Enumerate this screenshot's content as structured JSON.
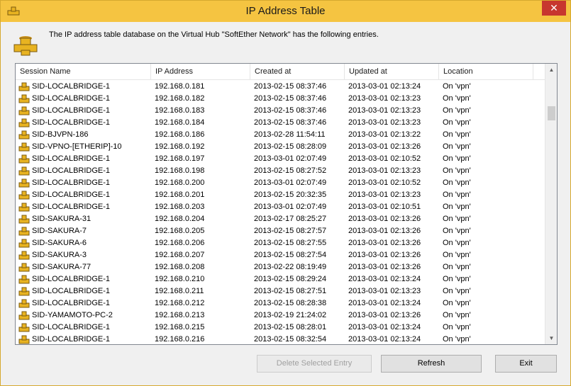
{
  "window": {
    "title": "IP Address Table",
    "close_glyph": "✕"
  },
  "description": "The IP address table database on the Virtual Hub \"SoftEther Network\" has the following entries.",
  "table": {
    "columns": [
      "Session Name",
      "IP Address",
      "Created at",
      "Updated at",
      "Location"
    ],
    "rows": [
      [
        "SID-LOCALBRIDGE-1",
        "192.168.0.181",
        "2013-02-15 08:37:46",
        "2013-03-01 02:13:24",
        "On 'vpn'"
      ],
      [
        "SID-LOCALBRIDGE-1",
        "192.168.0.182",
        "2013-02-15 08:37:46",
        "2013-03-01 02:13:23",
        "On 'vpn'"
      ],
      [
        "SID-LOCALBRIDGE-1",
        "192.168.0.183",
        "2013-02-15 08:37:46",
        "2013-03-01 02:13:23",
        "On 'vpn'"
      ],
      [
        "SID-LOCALBRIDGE-1",
        "192.168.0.184",
        "2013-02-15 08:37:46",
        "2013-03-01 02:13:23",
        "On 'vpn'"
      ],
      [
        "SID-BJVPN-186",
        "192.168.0.186",
        "2013-02-28 11:54:11",
        "2013-03-01 02:13:22",
        "On 'vpn'"
      ],
      [
        "SID-VPNO-[ETHERIP]-10",
        "192.168.0.192",
        "2013-02-15 08:28:09",
        "2013-03-01 02:13:26",
        "On 'vpn'"
      ],
      [
        "SID-LOCALBRIDGE-1",
        "192.168.0.197",
        "2013-03-01 02:07:49",
        "2013-03-01 02:10:52",
        "On 'vpn'"
      ],
      [
        "SID-LOCALBRIDGE-1",
        "192.168.0.198",
        "2013-02-15 08:27:52",
        "2013-03-01 02:13:23",
        "On 'vpn'"
      ],
      [
        "SID-LOCALBRIDGE-1",
        "192.168.0.200",
        "2013-03-01 02:07:49",
        "2013-03-01 02:10:52",
        "On 'vpn'"
      ],
      [
        "SID-LOCALBRIDGE-1",
        "192.168.0.201",
        "2013-02-15 20:32:35",
        "2013-03-01 02:13:23",
        "On 'vpn'"
      ],
      [
        "SID-LOCALBRIDGE-1",
        "192.168.0.203",
        "2013-03-01 02:07:49",
        "2013-03-01 02:10:51",
        "On 'vpn'"
      ],
      [
        "SID-SAKURA-31",
        "192.168.0.204",
        "2013-02-17 08:25:27",
        "2013-03-01 02:13:26",
        "On 'vpn'"
      ],
      [
        "SID-SAKURA-7",
        "192.168.0.205",
        "2013-02-15 08:27:57",
        "2013-03-01 02:13:26",
        "On 'vpn'"
      ],
      [
        "SID-SAKURA-6",
        "192.168.0.206",
        "2013-02-15 08:27:55",
        "2013-03-01 02:13:26",
        "On 'vpn'"
      ],
      [
        "SID-SAKURA-3",
        "192.168.0.207",
        "2013-02-15 08:27:54",
        "2013-03-01 02:13:26",
        "On 'vpn'"
      ],
      [
        "SID-SAKURA-77",
        "192.168.0.208",
        "2013-02-22 08:19:49",
        "2013-03-01 02:13:26",
        "On 'vpn'"
      ],
      [
        "SID-LOCALBRIDGE-1",
        "192.168.0.210",
        "2013-02-15 08:29:24",
        "2013-03-01 02:13:24",
        "On 'vpn'"
      ],
      [
        "SID-LOCALBRIDGE-1",
        "192.168.0.211",
        "2013-02-15 08:27:51",
        "2013-03-01 02:13:23",
        "On 'vpn'"
      ],
      [
        "SID-LOCALBRIDGE-1",
        "192.168.0.212",
        "2013-02-15 08:28:38",
        "2013-03-01 02:13:24",
        "On 'vpn'"
      ],
      [
        "SID-YAMAMOTO-PC-2",
        "192.168.0.213",
        "2013-02-19 21:24:02",
        "2013-03-01 02:13:26",
        "On 'vpn'"
      ],
      [
        "SID-LOCALBRIDGE-1",
        "192.168.0.215",
        "2013-02-15 08:28:01",
        "2013-03-01 02:13:24",
        "On 'vpn'"
      ],
      [
        "SID-LOCALBRIDGE-1",
        "192.168.0.216",
        "2013-02-15 08:32:54",
        "2013-03-01 02:13:24",
        "On 'vpn'"
      ]
    ]
  },
  "scrollbar": {
    "up_glyph": "▲",
    "down_glyph": "▼"
  },
  "buttons": {
    "delete_label": "Delete Selected Entry",
    "refresh_label": "Refresh",
    "exit_label": "Exit"
  },
  "icons": {
    "title": "pipe-icon",
    "hub": "pipe-icon",
    "row": "session-icon"
  },
  "colors": {
    "titlebar": "#f5c441",
    "close_button": "#c7372f",
    "icon_gold": "#e8b321"
  }
}
